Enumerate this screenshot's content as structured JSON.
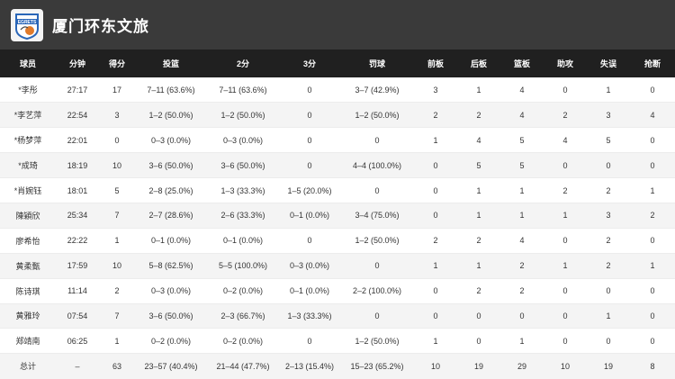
{
  "header": {
    "team_name": "厦门环东文旅",
    "logo_text": "EGRETS",
    "logo_icon": "egret-basketball-logo-icon"
  },
  "columns": [
    "球员",
    "分钟",
    "得分",
    "投篮",
    "2分",
    "3分",
    "罚球",
    "前板",
    "后板",
    "篮板",
    "助攻",
    "失误",
    "抢断"
  ],
  "rows": [
    [
      "*李彤",
      "27:17",
      "17",
      "7–11 (63.6%)",
      "7–11 (63.6%)",
      "0",
      "3–7 (42.9%)",
      "3",
      "1",
      "4",
      "0",
      "1",
      "0"
    ],
    [
      "*李艺萍",
      "22:54",
      "3",
      "1–2 (50.0%)",
      "1–2 (50.0%)",
      "0",
      "1–2 (50.0%)",
      "2",
      "2",
      "4",
      "2",
      "3",
      "4"
    ],
    [
      "*杨梦萍",
      "22:01",
      "0",
      "0–3 (0.0%)",
      "0–3 (0.0%)",
      "0",
      "0",
      "1",
      "4",
      "5",
      "4",
      "5",
      "0"
    ],
    [
      "*成琦",
      "18:19",
      "10",
      "3–6 (50.0%)",
      "3–6 (50.0%)",
      "0",
      "4–4 (100.0%)",
      "0",
      "5",
      "5",
      "0",
      "0",
      "0"
    ],
    [
      "*肖婉钰",
      "18:01",
      "5",
      "2–8 (25.0%)",
      "1–3 (33.3%)",
      "1–5 (20.0%)",
      "0",
      "0",
      "1",
      "1",
      "2",
      "2",
      "1"
    ],
    [
      "陳穎欣",
      "25:34",
      "7",
      "2–7 (28.6%)",
      "2–6 (33.3%)",
      "0–1 (0.0%)",
      "3–4 (75.0%)",
      "0",
      "1",
      "1",
      "1",
      "3",
      "2"
    ],
    [
      "廖希怡",
      "22:22",
      "1",
      "0–1 (0.0%)",
      "0–1 (0.0%)",
      "0",
      "1–2 (50.0%)",
      "2",
      "2",
      "4",
      "0",
      "2",
      "0"
    ],
    [
      "黄柔甄",
      "17:59",
      "10",
      "5–8 (62.5%)",
      "5–5 (100.0%)",
      "0–3 (0.0%)",
      "0",
      "1",
      "1",
      "2",
      "1",
      "2",
      "1"
    ],
    [
      "陈诗琪",
      "11:14",
      "2",
      "0–3 (0.0%)",
      "0–2 (0.0%)",
      "0–1 (0.0%)",
      "2–2 (100.0%)",
      "0",
      "2",
      "2",
      "0",
      "0",
      "0"
    ],
    [
      "黄雅玲",
      "07:54",
      "7",
      "3–6 (50.0%)",
      "2–3 (66.7%)",
      "1–3 (33.3%)",
      "0",
      "0",
      "0",
      "0",
      "0",
      "1",
      "0"
    ],
    [
      "郑靖南",
      "06:25",
      "1",
      "0–2 (0.0%)",
      "0–2 (0.0%)",
      "0",
      "1–2 (50.0%)",
      "1",
      "0",
      "1",
      "0",
      "0",
      "0"
    ],
    [
      "总计",
      "–",
      "63",
      "23–57 (40.4%)",
      "21–44 (47.7%)",
      "2–13 (15.4%)",
      "15–23 (65.2%)",
      "10",
      "19",
      "29",
      "10",
      "19",
      "8"
    ]
  ],
  "colors": {
    "header_bg": "#3a3a3a",
    "table_head_bg": "#202020",
    "stripe": "#f4f4f4",
    "logo_blue": "#2a66b8"
  }
}
